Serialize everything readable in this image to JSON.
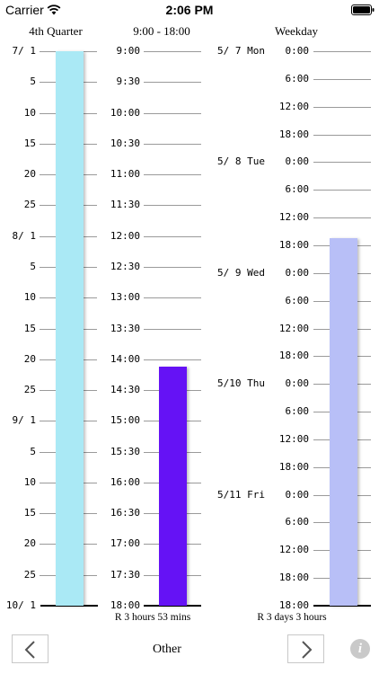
{
  "status_bar": {
    "carrier": "Carrier",
    "time": "2:06 PM",
    "icons": [
      "wifi-icon",
      "battery-icon"
    ]
  },
  "columns": {
    "quarter": {
      "title": "4th Quarter",
      "ticks": [
        "7/ 1",
        "5",
        "10",
        "15",
        "20",
        "25",
        "8/ 1",
        "5",
        "10",
        "15",
        "20",
        "25",
        "9/ 1",
        "5",
        "10",
        "15",
        "20",
        "25",
        "10/ 1"
      ],
      "elapsed_fraction": 1.0,
      "bar_color": "#aae9f5"
    },
    "workhours": {
      "title": "9:00 - 18:00",
      "ticks": [
        "9:00",
        "9:30",
        "10:00",
        "10:30",
        "11:00",
        "11:30",
        "12:00",
        "12:30",
        "13:00",
        "13:30",
        "14:00",
        "14:30",
        "15:00",
        "15:30",
        "16:00",
        "16:30",
        "17:00",
        "17:30",
        "18:00"
      ],
      "remaining_label": "R 3 hours 53 mins",
      "remaining_fraction": 0.4315,
      "bar_color": "#6512f5"
    },
    "weekday": {
      "title": "Weekday",
      "day_labels": [
        "5/ 7 Mon",
        "5/ 8 Tue",
        "5/ 9 Wed",
        "5/10 Thu",
        "5/11 Fri"
      ],
      "ticks": [
        "0:00",
        "6:00",
        "12:00",
        "18:00",
        "0:00",
        "6:00",
        "12:00",
        "18:00",
        "0:00",
        "6:00",
        "12:00",
        "18:00",
        "0:00",
        "6:00",
        "12:00",
        "18:00",
        "0:00",
        "6:00",
        "12:00",
        "18:00",
        "18:00"
      ],
      "remaining_label": "R 3 days 3 hours",
      "remaining_fraction": 0.6625,
      "bar_color": "#b8bff7"
    }
  },
  "toolbar": {
    "title": "Other",
    "prev_icon": "chevron-left-icon",
    "next_icon": "chevron-right-icon",
    "info_icon": "info-icon",
    "info_glyph": "i"
  }
}
